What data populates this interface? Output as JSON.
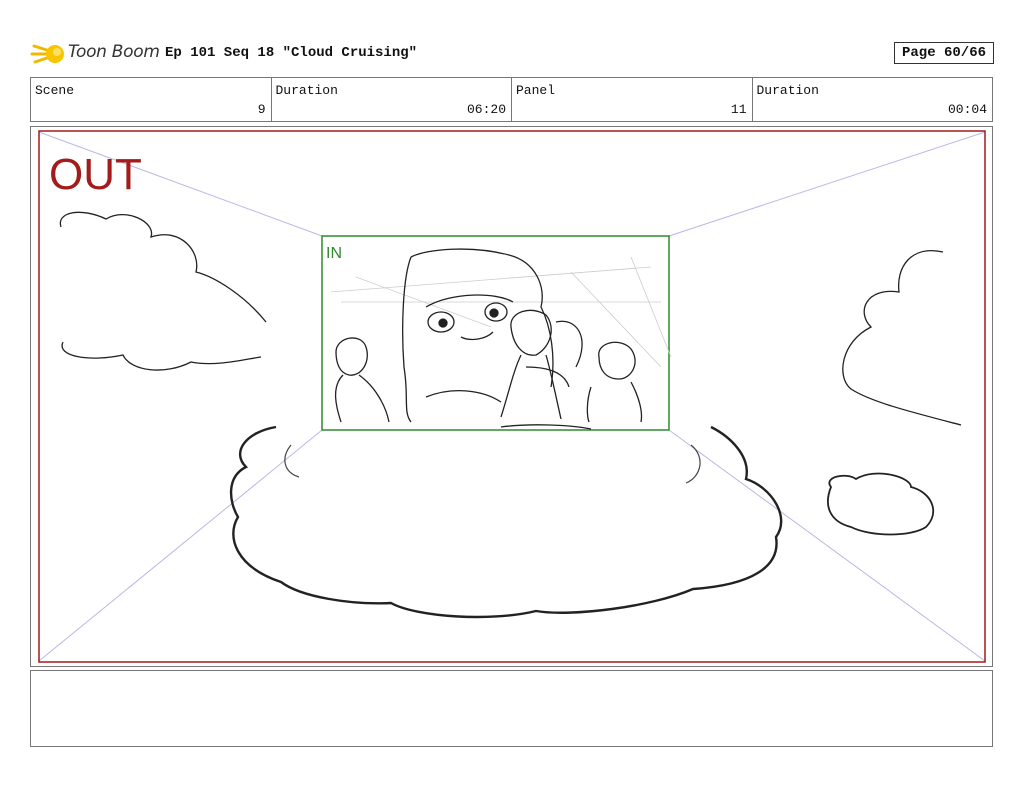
{
  "header": {
    "brand": "Toon Boom",
    "title": "Ep 101 Seq 18 \"Cloud Cruising\"",
    "page": "Page 60/66"
  },
  "info": {
    "scene_label": "Scene",
    "scene_value": "9",
    "scene_duration_label": "Duration",
    "scene_duration_value": "06:20",
    "panel_label": "Panel",
    "panel_value": "11",
    "panel_duration_label": "Duration",
    "panel_duration_value": "00:04"
  },
  "frame": {
    "out_label": "OUT",
    "in_label": "IN",
    "out_color": "#a31b1b",
    "in_color": "#2e8b2e",
    "guide_color": "#b8b8e8"
  },
  "notes": ""
}
